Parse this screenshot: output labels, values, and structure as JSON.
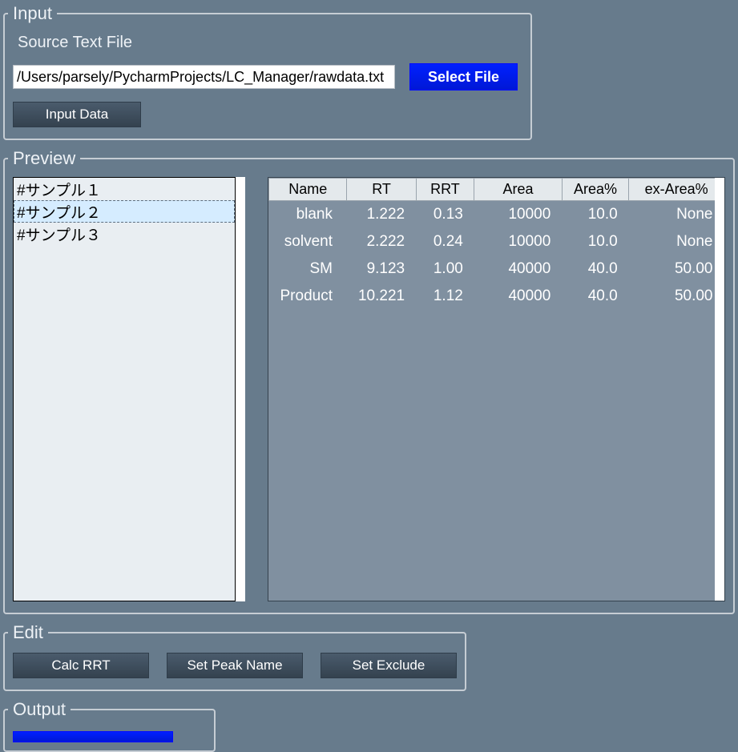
{
  "input": {
    "legend": "Input",
    "subtitle": "Source Text File",
    "path_value": "/Users/parsely/PycharmProjects/LC_Manager/rawdata.txt",
    "select_file_label": "Select File",
    "input_data_label": "Input Data"
  },
  "preview": {
    "legend": "Preview",
    "samples": [
      {
        "label": "#サンプル１",
        "selected": false
      },
      {
        "label": "#サンプル２",
        "selected": true
      },
      {
        "label": "#サンプル３",
        "selected": false
      }
    ],
    "columns": [
      "Name",
      "RT",
      "RRT",
      "Area",
      "Area%",
      "ex-Area%"
    ],
    "rows": [
      {
        "name": "blank",
        "rt": "1.222",
        "rrt": "0.13",
        "area": "10000",
        "area_pct": "10.0",
        "ex": "None"
      },
      {
        "name": "solvent",
        "rt": "2.222",
        "rrt": "0.24",
        "area": "10000",
        "area_pct": "10.0",
        "ex": "None"
      },
      {
        "name": "SM",
        "rt": "9.123",
        "rrt": "1.00",
        "area": "40000",
        "area_pct": "40.0",
        "ex": "50.00"
      },
      {
        "name": "Product",
        "rt": "10.221",
        "rrt": "1.12",
        "area": "40000",
        "area_pct": "40.0",
        "ex": "50.00"
      }
    ]
  },
  "edit": {
    "legend": "Edit",
    "calc_rrt_label": "Calc RRT",
    "set_peak_name_label": "Set Peak Name",
    "set_exclude_label": "Set Exclude"
  },
  "output": {
    "legend": "Output"
  }
}
